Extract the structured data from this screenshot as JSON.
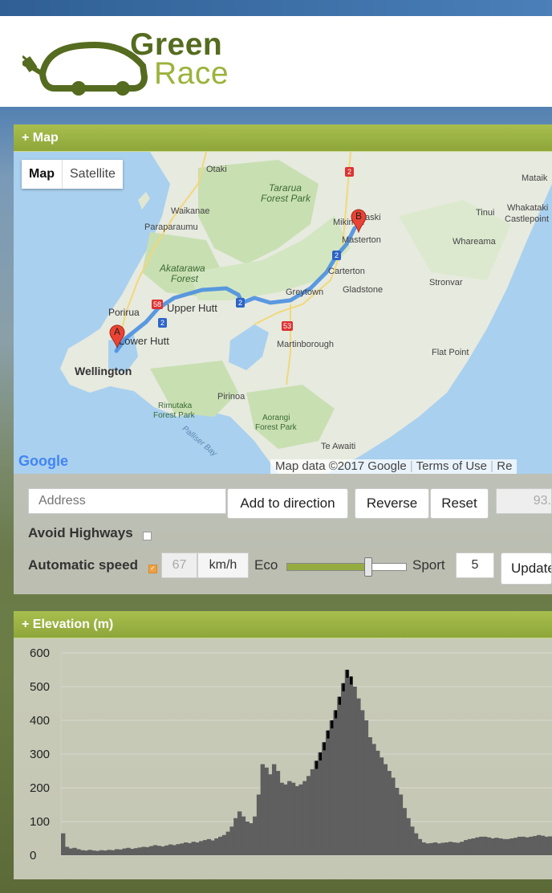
{
  "brand": {
    "line1": "Green",
    "line2": "Race"
  },
  "map_panel": {
    "title": "+ Map",
    "map_type": {
      "map": "Map",
      "satellite": "Satellite"
    },
    "places": {
      "otaki": "Otaki",
      "tararua": "Tararua",
      "forest_park": "Forest Park",
      "mikimiki": "Mikimiki",
      "masterton": "Masterton",
      "waikanae": "Waikanae",
      "paraparaumu": "Paraparaumu",
      "akatarawa": "Akatarawa",
      "forest": "Forest",
      "carterton": "Carterton",
      "gladstone": "Gladstone",
      "greytown": "Greytown",
      "porirua": "Porirua",
      "upper_hutt": "Upper Hutt",
      "lower_hutt": "Lower Hutt",
      "wellington": "Wellington",
      "martinborough": "Martinborough",
      "pirinoa": "Pirinoa",
      "rimutaka": "Rimutaka",
      "rimutaka_fp": "Forest Park",
      "aorangi": "Aorangi",
      "aorangi_fp": "Forest Park",
      "palliser_bay": "Palliser Bay",
      "te_awaiti": "Te Awaiti",
      "flat_point": "Flat Point",
      "stronvar": "Stronvar",
      "whareama": "Whareama",
      "tinui": "Tinui",
      "mataikona": "Mataik",
      "whakataki": "Whakataki",
      "castlepoint": "Castlepoint",
      "marker_a": "A",
      "marker_b": "B",
      "aski": "aski"
    },
    "roads": {
      "r58": "58",
      "r2a": "2",
      "r2b": "2",
      "r2c": "2",
      "r53": "53",
      "r2top": "2"
    },
    "google": "Google",
    "attribution": "Map data ©2017 Google",
    "terms": "Terms of Use",
    "report": "Re"
  },
  "controls": {
    "address_placeholder": "Address",
    "add_to_direction": "Add to direction",
    "reverse": "Reverse",
    "reset": "Reset",
    "distance": "93.",
    "avoid_highways": "Avoid Highways",
    "automatic_speed": "Automatic speed",
    "speed_value": "67",
    "speed_unit": "km/h",
    "eco": "Eco",
    "sport": "Sport",
    "slider_level": 0.68,
    "sport_value": "5",
    "update": "Update"
  },
  "elevation_panel": {
    "title": "+ Elevation (m)"
  },
  "chart_data": {
    "type": "area",
    "title": "",
    "xlabel": "",
    "ylabel": "",
    "ylim": [
      0,
      600
    ],
    "yticks": [
      "600",
      "500",
      "400",
      "300",
      "200",
      "100",
      "0"
    ],
    "grid": true,
    "series": [
      {
        "values": [
          65,
          25,
          20,
          22,
          18,
          15,
          14,
          16,
          14,
          13,
          15,
          14,
          16,
          15,
          18,
          17,
          20,
          22,
          19,
          21,
          23,
          25,
          24,
          27,
          30,
          28,
          26,
          29,
          32,
          30,
          33,
          35,
          38,
          36,
          40,
          38,
          42,
          45,
          48,
          44,
          50,
          55,
          60,
          70,
          85,
          110,
          130,
          115,
          100,
          95,
          115,
          180,
          270,
          260,
          240,
          270,
          250,
          215,
          210,
          220,
          215,
          205,
          210,
          220,
          235,
          255,
          280,
          305,
          335,
          370,
          400,
          430,
          470,
          510,
          550,
          530,
          500,
          465,
          430,
          400,
          350,
          330,
          310,
          290,
          270,
          250,
          230,
          200,
          180,
          140,
          110,
          85,
          65,
          48,
          38,
          35,
          36,
          38,
          35,
          37,
          38,
          40,
          38,
          37,
          40,
          45,
          48,
          50,
          53,
          55,
          55,
          53,
          50,
          52,
          50,
          48,
          48,
          50,
          52,
          55,
          55,
          53,
          55,
          57,
          60,
          58,
          55,
          56
        ],
        "highlight_range": [
          66,
          75
        ]
      }
    ]
  }
}
